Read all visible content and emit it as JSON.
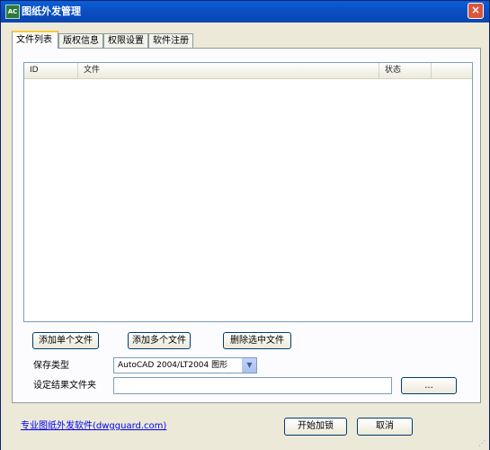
{
  "window": {
    "title": "图纸外发管理",
    "icon_text": "AC",
    "close_symbol": "×"
  },
  "tabs": [
    "文件列表",
    "版权信息",
    "权限设置",
    "软件注册"
  ],
  "file_list": {
    "columns": [
      "ID",
      "文件",
      "状态"
    ],
    "rows": []
  },
  "buttons": {
    "add_single": "添加单个文件",
    "add_multiple": "添加多个文件",
    "delete_selected": "删除选中文件",
    "browse": "...",
    "start": "开始加锁",
    "cancel": "取消"
  },
  "save_type": {
    "label": "保存类型",
    "value": "AutoCAD 2004/LT2004 图形",
    "arrow": "▼"
  },
  "output_folder": {
    "label": "设定结果文件夹",
    "value": ""
  },
  "footer_link": "专业图纸外发软件(dwgguard.com)",
  "grip_symbol": "⋰"
}
